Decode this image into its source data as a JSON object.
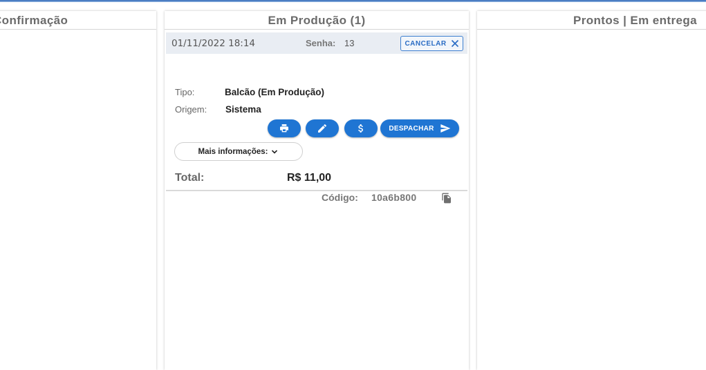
{
  "columns": {
    "confirmacao": {
      "title": "Confirmação"
    },
    "producao": {
      "title": "Em Produção (1)"
    },
    "prontos": {
      "title": "Prontos | Em entrega"
    }
  },
  "order": {
    "datetime": "01/11/2022 18:14",
    "senha_label": "Senha:",
    "senha_value": "13",
    "cancel_label": "CANCELAR",
    "tipo_label": "Tipo:",
    "tipo_value": "Balcão (Em Produção)",
    "origem_label": "Origem:",
    "origem_value": "Sistema",
    "despachar_label": "DESPACHAR",
    "more_info_label": "Mais informações:",
    "total_label": "Total:",
    "total_value": "R$ 11,00",
    "codigo_label": "Código:",
    "codigo_value": "10a6b800"
  },
  "icons": {
    "print": "print-icon",
    "edit": "pencil-icon",
    "payment": "dollar-icon",
    "send": "send-icon",
    "close": "close-icon",
    "expand": "chevron-down-icon",
    "copy": "copy-icon"
  },
  "colors": {
    "accent": "#1f75d3",
    "header_text": "#6b6b6b",
    "card_head_bg": "#e9edf3"
  }
}
